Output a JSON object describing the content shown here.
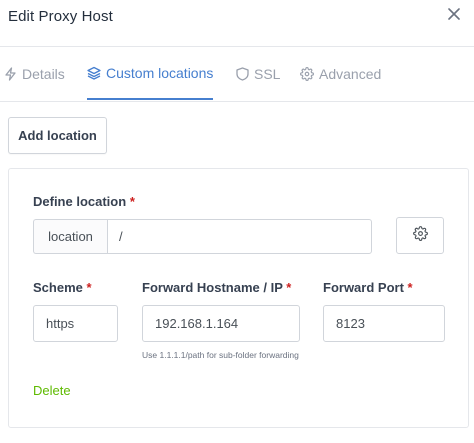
{
  "modal": {
    "title": "Edit Proxy Host",
    "close_icon": "close-icon"
  },
  "tabs": [
    {
      "label": "Details",
      "icon": "bolt-icon",
      "active": false
    },
    {
      "label": "Custom locations",
      "icon": "layers-icon",
      "active": true
    },
    {
      "label": "SSL",
      "icon": "shield-icon",
      "active": false
    },
    {
      "label": "Advanced",
      "icon": "gear-icon",
      "active": false
    }
  ],
  "toolbar": {
    "add_location_label": "Add location"
  },
  "location": {
    "define_label": "Define location",
    "required_marker": "*",
    "addon_label": "location",
    "path_value": "/",
    "advanced_icon": "gear-icon",
    "scheme_label": "Scheme",
    "scheme_value": "https",
    "hostname_label": "Forward Hostname / IP",
    "hostname_value": "192.168.1.164",
    "hostname_help": "Use 1.1.1.1/path for sub-folder forwarding",
    "port_label": "Forward Port",
    "port_value": "8123",
    "delete_label": "Delete"
  },
  "colors": {
    "accent": "#467fcf",
    "required": "#cd201f",
    "delete": "#5eba00",
    "muted": "#9aa0ac"
  }
}
